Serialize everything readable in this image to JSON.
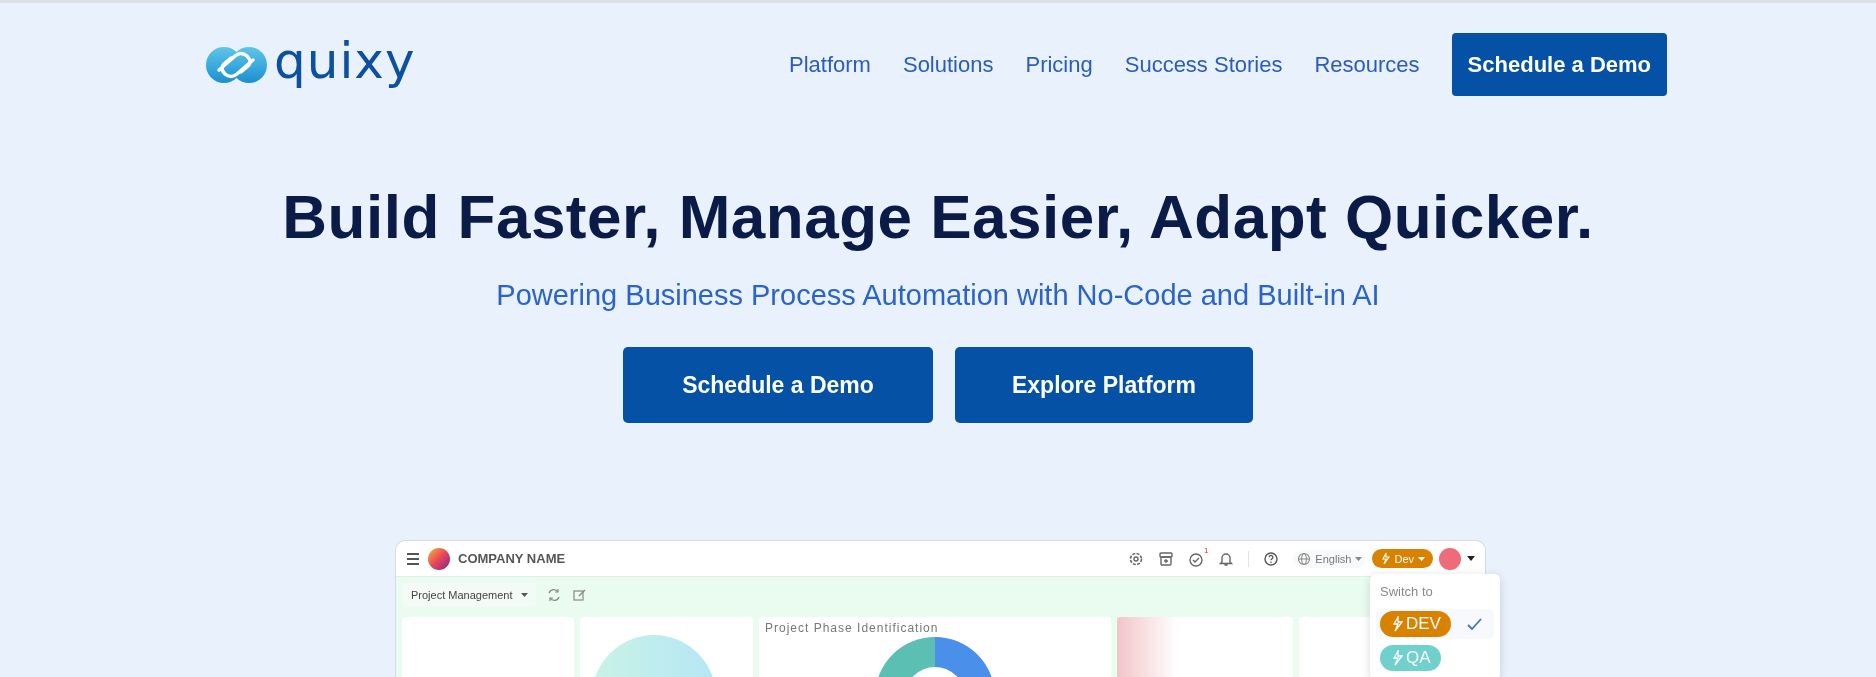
{
  "logo": {
    "text": "quixy"
  },
  "nav": {
    "links": [
      "Platform",
      "Solutions",
      "Pricing",
      "Success Stories",
      "Resources"
    ],
    "cta": "Schedule a Demo"
  },
  "hero": {
    "title": "Build Faster, Manage Easier, Adapt Quicker.",
    "subtitle": "Powering Business Process Automation with No-Code and Built-in AI",
    "buttons": [
      "Schedule a Demo",
      "Explore Platform"
    ]
  },
  "app": {
    "company": "COMPANY NAME",
    "project_select": "Project Management",
    "notification_count": "1",
    "language": "English",
    "env_button": "Dev",
    "panel_title": "Project Phase Identification",
    "env_menu": {
      "title": "Switch to",
      "items": [
        {
          "label": "DEV",
          "color": "#d98200",
          "selected": true
        },
        {
          "label": "QA",
          "color": "#6fd0cc",
          "selected": false
        }
      ]
    }
  }
}
